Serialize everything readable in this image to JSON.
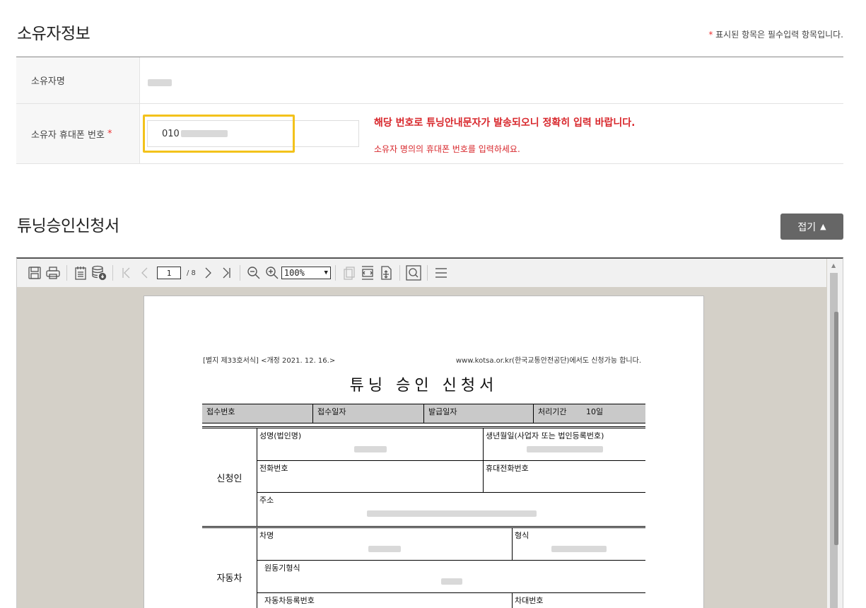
{
  "owner_section": {
    "title": "소유자정보",
    "required_note_star": "*",
    "required_note": "표시된 항목은 필수입력 항목입니다.",
    "name_label": "소유자명",
    "phone_label": "소유자 휴대폰 번호",
    "phone_required_star": "*",
    "phone_value_prefix": "010",
    "phone_notice": "해당 번호로 튜닝안내문자가 발송되오니 정확히 입력 바랍니다.",
    "phone_hint": "소유자 명의의 휴대폰 번호를 입력하세요."
  },
  "form_section": {
    "title": "튜닝승인신청서",
    "fold_button_label": "접기",
    "fold_button_icon": "▲"
  },
  "pdf_viewer": {
    "current_page": "1",
    "total_pages": "/ 8",
    "zoom": "100%",
    "toolbar_icons": [
      "save-icon",
      "print-icon",
      "notes-icon",
      "database-download-icon",
      "first-page-icon",
      "prev-page-icon",
      "next-page-icon",
      "last-page-icon",
      "zoom-out-icon",
      "zoom-in-icon",
      "copy-icon",
      "fit-width-icon",
      "fit-page-icon",
      "search-icon",
      "menu-icon"
    ]
  },
  "document": {
    "annex": "[별지 제33호서식] <개정 2021. 12. 16.>",
    "kotsa_note": "www.kotsa.or.kr(한국교통안전공단)에서도 신청가능 합니다.",
    "title": "튜닝 승인 신청서",
    "meta": {
      "receipt_no": "접수번호",
      "receipt_date": "접수일자",
      "issue_date": "발급일자",
      "process_period": "처리기간",
      "process_days": "10일"
    },
    "applicant": {
      "label": "신청인",
      "name_label": "성명(법인명)",
      "birth_label": "생년월일(사업자 또는 법인등록번호)",
      "phone_label": "전화번호",
      "mobile_label": "휴대전화번호",
      "address_label": "주소"
    },
    "vehicle": {
      "label": "자동차",
      "car_name_label": "차명",
      "model_label": "형식",
      "engine_label": "원동기형식",
      "reg_no_label": "자동차등록번호",
      "vin_label": "차대번호"
    }
  }
}
